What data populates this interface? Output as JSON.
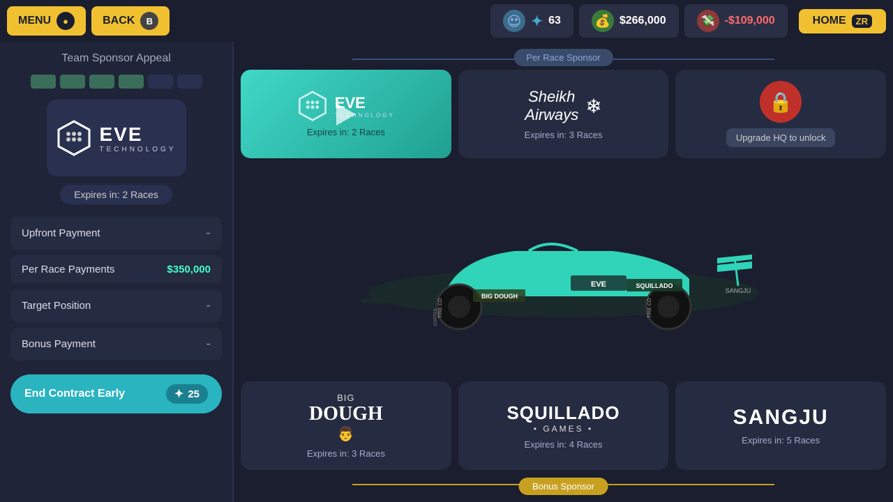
{
  "topBar": {
    "menu_label": "MENU",
    "menu_badge": "●",
    "back_label": "BACK",
    "back_badge": "B",
    "fans_count": "63",
    "money_amount": "$266,000",
    "debt_amount": "-$109,000",
    "home_label": "HOME",
    "home_badge": "ZR"
  },
  "leftPanel": {
    "title": "Team Sponsor Appeal",
    "sponsor_name": "EVE TECHNOLOGY",
    "sponsor_big": "EVE",
    "sponsor_small": "TECHNOLOGY",
    "expires_label": "Expires in: 2 Races",
    "upfront_label": "Upfront Payment",
    "upfront_value": "-",
    "per_race_label": "Per Race Payments",
    "per_race_value": "$350,000",
    "target_label": "Target Position",
    "target_value": "-",
    "bonus_label": "Bonus Payment",
    "bonus_value": "-",
    "end_contract_label": "End Contract Early",
    "end_contract_cost": "25"
  },
  "rightPanel": {
    "per_race_sponsor_label": "Per Race Sponsor",
    "bonus_sponsor_label": "Bonus Sponsor",
    "sponsors_top": [
      {
        "id": "eve",
        "name": "EVE TECHNOLOGY",
        "expires": "Expires in: 2 Races",
        "active": true
      },
      {
        "id": "sheikh",
        "name": "Sheikh Airways",
        "expires": "Expires in: 3 Races",
        "active": false
      },
      {
        "id": "locked1",
        "name": "Locked",
        "expires": "Upgrade HQ to unlock",
        "active": false,
        "locked": true
      }
    ],
    "sponsors_bottom": [
      {
        "id": "bigdough",
        "name": "Big Dough",
        "expires": "Expires in: 3 Races"
      },
      {
        "id": "squillado",
        "name": "Squillado Games",
        "expires": "Expires in: 4 Races"
      },
      {
        "id": "sangju",
        "name": "SANGJU",
        "expires": "Expires in: 5 Races"
      }
    ]
  }
}
